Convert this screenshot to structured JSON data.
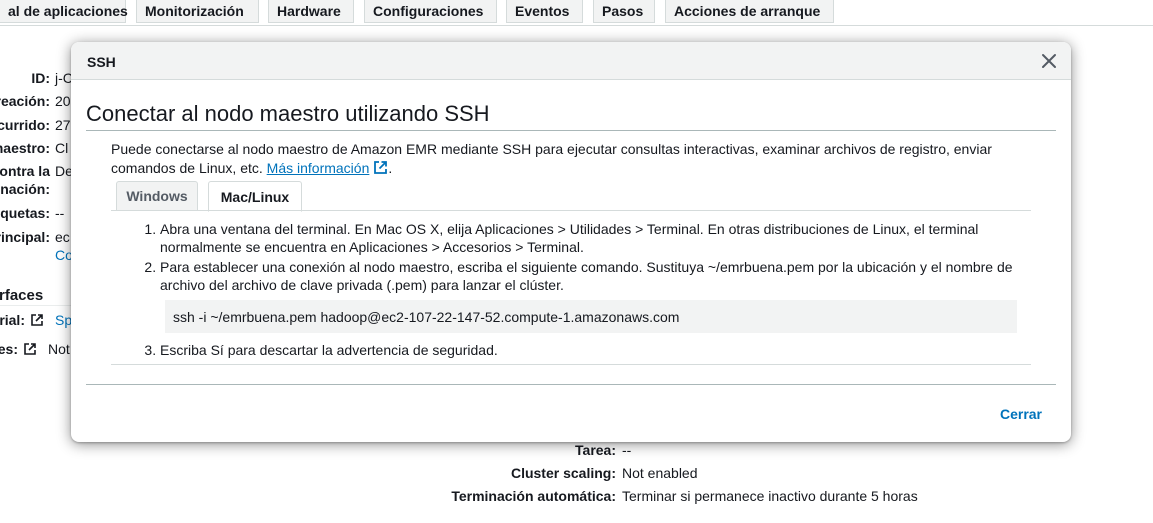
{
  "background": {
    "tabs": [
      "al de aplicaciones",
      "Monitorización",
      "Hardware",
      "Configuraciones",
      "Eventos",
      "Pasos",
      "Acciones de arranque"
    ],
    "summary": [
      {
        "label": "ID:",
        "value": "j-C"
      },
      {
        "label": "reación:",
        "value": "20"
      },
      {
        "label": "currido:",
        "value": "27"
      },
      {
        "label": "maestro:",
        "value": "Cl"
      },
      {
        "label_line1": "ontra la",
        "label_line2": "nación:",
        "value": "De"
      },
      {
        "label": "quetas:",
        "value": "--"
      },
      {
        "label": "rincipal:",
        "value": "ec",
        "value_line2": "Co"
      }
    ],
    "interfaces_heading": "rfaces",
    "interfaces": [
      {
        "label": "rial:",
        "value": "Sp"
      },
      {
        "label": "es:",
        "value": "Not"
      }
    ],
    "bottom_fields": [
      {
        "label": "Tarea:",
        "value": "--"
      },
      {
        "label": "Cluster scaling:",
        "value": "Not enabled"
      },
      {
        "label": "Terminación automática:",
        "value": "Terminar si permanece inactivo durante 5 horas"
      }
    ]
  },
  "modal": {
    "title": "SSH",
    "heading": "Conectar al nodo maestro utilizando SSH",
    "intro_text": "Puede conectarse al nodo maestro de Amazon EMR mediante SSH para ejecutar consultas interactivas, examinar archivos de registro, enviar comandos de Linux, etc.",
    "more_info_link": "Más información",
    "tabs": {
      "windows": "Windows",
      "mac_linux": "Mac/Linux",
      "active": "mac_linux"
    },
    "steps": [
      "Abra una ventana del terminal. En Mac OS X, elija Aplicaciones > Utilidades > Terminal. En otras distribuciones de Linux, el terminal normalmente se encuentra en Aplicaciones > Accesorios > Terminal.",
      "Para establecer una conexión al nodo maestro, escriba el siguiente comando. Sustituya ~/emrbuena.pem por la ubicación y el nombre de archivo del archivo de clave privada (.pem) para lanzar el clúster.",
      "Escriba Sí para descartar la advertencia de seguridad."
    ],
    "command": "ssh -i ~/emrbuena.pem hadoop@ec2-107-22-147-52.compute-1.amazonaws.com",
    "close_label": "Cerrar",
    "icons": {
      "close": "close-icon",
      "external": "external-link-icon"
    },
    "colors": {
      "link": "#0073bb",
      "header_bg": "#f2f3f3",
      "command_bg": "#f2f3f3"
    }
  }
}
